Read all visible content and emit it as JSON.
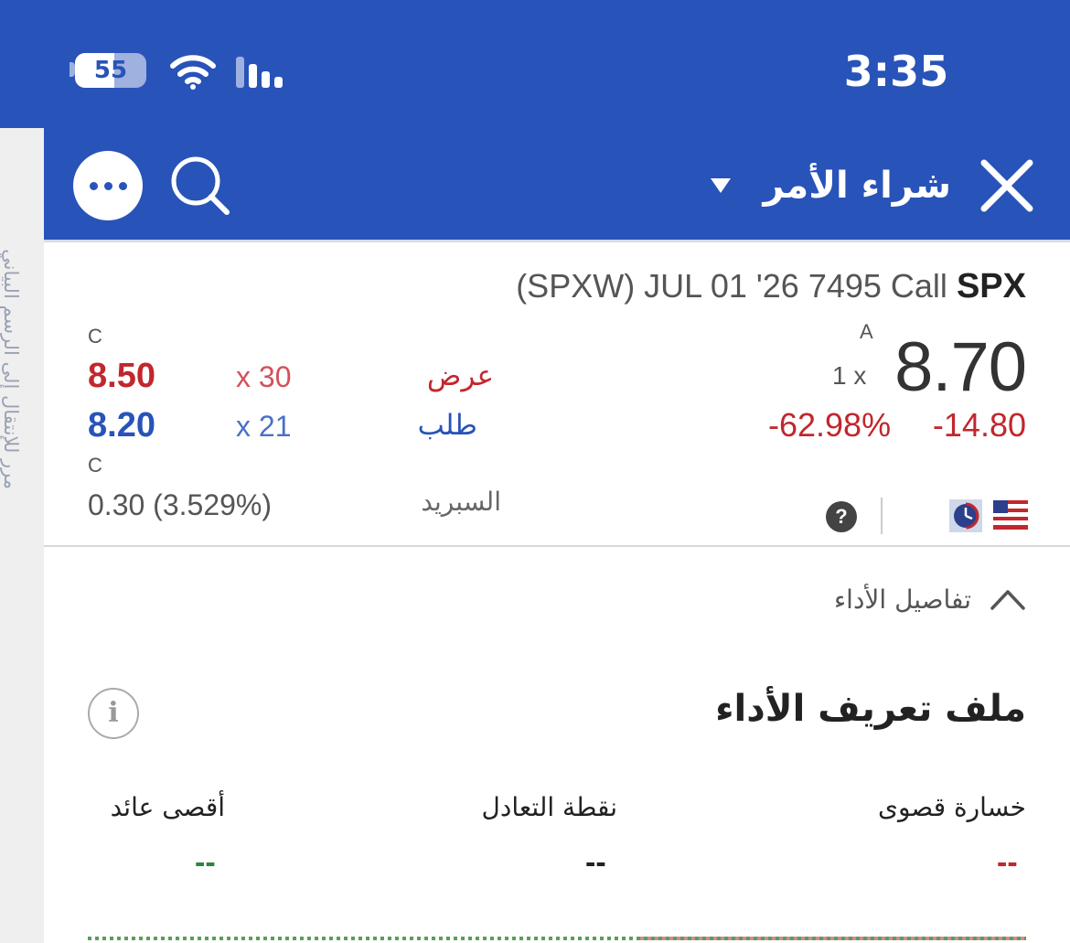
{
  "status_bar": {
    "time": "3:35",
    "battery": "55",
    "battery_level_percent": 55
  },
  "side_strip": {
    "text": "مرر للإنتقال إلى الرسم البياني"
  },
  "header": {
    "title": "شراء الأمر",
    "background_color": "#2853b8"
  },
  "instrument": {
    "symbol": "SPX",
    "description": "(SPXW) JUL 01 '26 7495 Call"
  },
  "last": {
    "exchange_flag": "A",
    "size": "1 x",
    "price": "8.70",
    "change": "-14.80",
    "change_percent": "-62.98%"
  },
  "ask": {
    "exchange_flag": "C",
    "price": "8.50",
    "size": "x 30",
    "label": "عرض",
    "color": "#c1272d"
  },
  "bid": {
    "exchange_flag": "C",
    "price": "8.20",
    "size": "x 21",
    "label": "طلب",
    "color": "#2853b8"
  },
  "spread": {
    "label": "السبريد",
    "value": "0.30 (3.529%)"
  },
  "icons": {
    "help": "?",
    "info": "i"
  },
  "performance": {
    "section_label": "تفاصيل الأداء",
    "profile_title": "ملف تعريف الأداء",
    "max_loss": {
      "label": "خسارة قصوى",
      "value": "--",
      "color": "#c1272d"
    },
    "breakeven": {
      "label": "نقطة التعادل",
      "value": "--",
      "color": "#222222"
    },
    "max_return": {
      "label": "أقصى عائد",
      "value": "--",
      "color": "#2e8540"
    }
  }
}
